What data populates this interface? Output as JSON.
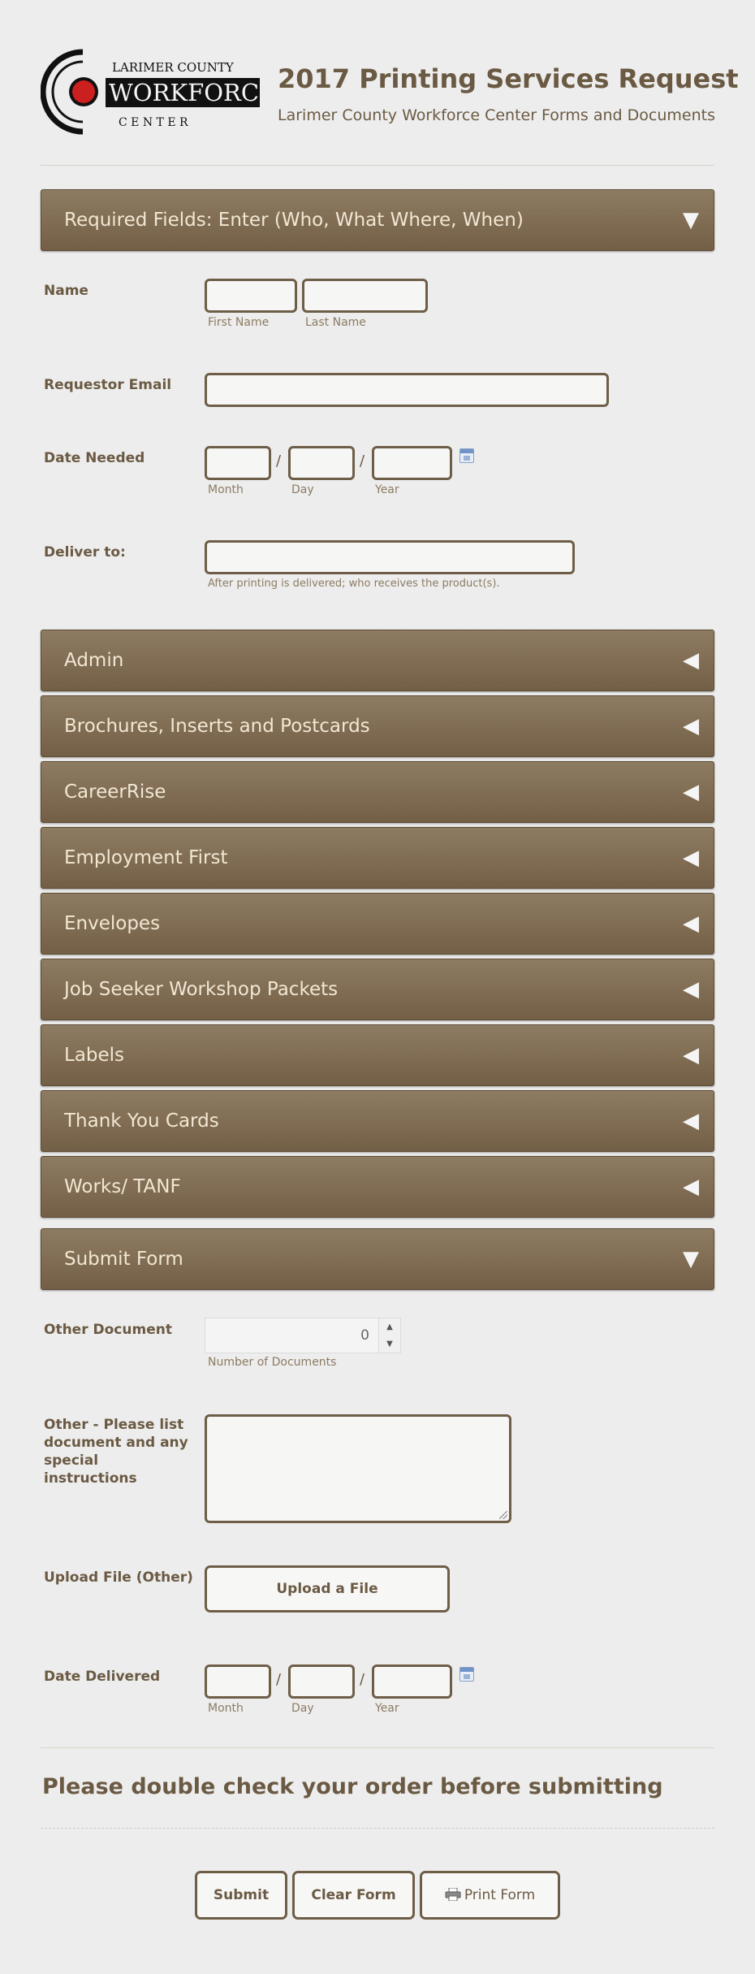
{
  "header": {
    "logo": {
      "top_text": "LARIMER COUNTY",
      "main_text": "WORKFORCE",
      "bottom_text": "C E N T E R"
    },
    "title": "2017 Printing Services Request",
    "subtitle": "Larimer County Workforce Center Forms and Documents"
  },
  "sections": {
    "required": {
      "label": "Required Fields: Enter (Who, What Where, When)",
      "arrow": "▼",
      "state": "expanded"
    },
    "collapsed": [
      {
        "label": "Admin",
        "arrow": "◀"
      },
      {
        "label": "Brochures, Inserts and Postcards",
        "arrow": "◀"
      },
      {
        "label": "CareerRise",
        "arrow": "◀"
      },
      {
        "label": "Employment First",
        "arrow": "◀"
      },
      {
        "label": "Envelopes",
        "arrow": "◀"
      },
      {
        "label": "Job Seeker Workshop Packets",
        "arrow": "◀"
      },
      {
        "label": "Labels",
        "arrow": "◀"
      },
      {
        "label": "Thank You Cards",
        "arrow": "◀"
      },
      {
        "label": "Works/ TANF",
        "arrow": "◀"
      }
    ],
    "submit": {
      "label": "Submit Form",
      "arrow": "▼",
      "state": "expanded"
    }
  },
  "required_fields": {
    "name": {
      "label": "Name",
      "first_sub": "First Name",
      "last_sub": "Last Name",
      "first_value": "",
      "last_value": ""
    },
    "email": {
      "label": "Requestor Email",
      "value": ""
    },
    "date_needed": {
      "label": "Date Needed",
      "month_sub": "Month",
      "day_sub": "Day",
      "year_sub": "Year",
      "separator": "/"
    },
    "deliver_to": {
      "label": "Deliver to:",
      "value": "",
      "help": "After printing is delivered; who receives the product(s)."
    }
  },
  "submit_fields": {
    "other_document": {
      "label": "Other Document",
      "value": "0",
      "sub": "Number of Documents",
      "up": "▲",
      "down": "▼"
    },
    "other_list": {
      "label": "Other - Please list document and any special instructions",
      "value": ""
    },
    "upload": {
      "label": "Upload File (Other)",
      "button": "Upload a File"
    },
    "date_delivered": {
      "label": "Date Delivered",
      "month_sub": "Month",
      "day_sub": "Day",
      "year_sub": "Year",
      "separator": "/"
    }
  },
  "notice": "Please double check your order before submitting",
  "buttons": {
    "submit": "Submit",
    "clear": "Clear Form",
    "print": "Print Form"
  },
  "icons": {
    "calendar": "calendar-icon",
    "printer": "printer-icon"
  },
  "colors": {
    "accent_brown": "#735f46",
    "text_brown": "#6b5a43",
    "bar_text": "#f1e7d4",
    "logo_red": "#cc1f1f",
    "background": "#ededed"
  }
}
